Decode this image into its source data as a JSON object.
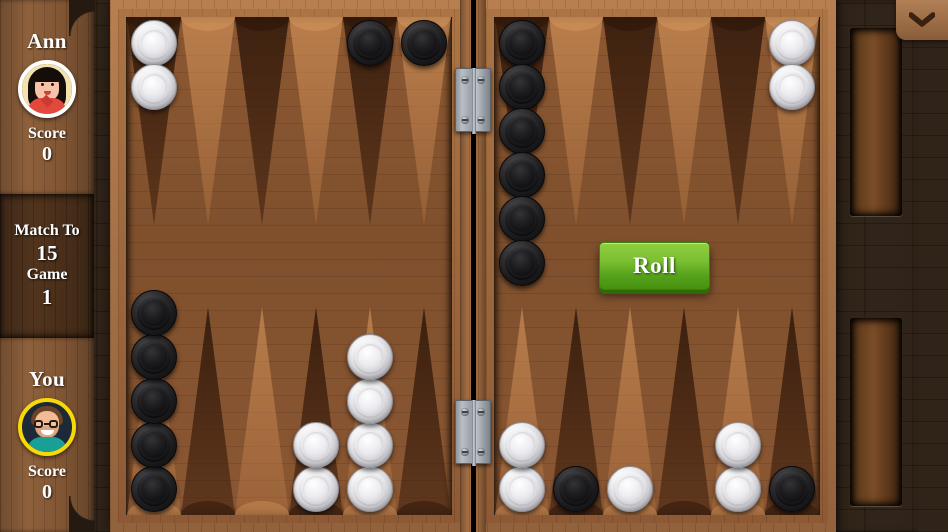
{
  "game": {
    "title": "Backgammon",
    "menu_icon": "chevron-down-icon"
  },
  "sidebar": {
    "opponent": {
      "name": "Ann",
      "avatar_icon": "avatar-ann",
      "score_label": "Score",
      "score_value": "0",
      "ring_color": "#ffffff",
      "active": false
    },
    "match": {
      "match_to_label": "Match To",
      "match_to_value": "15",
      "game_label": "Game",
      "game_value": "1"
    },
    "player": {
      "name": "You",
      "avatar_icon": "avatar-you",
      "score_label": "Score",
      "score_value": "0",
      "ring_color": "#f5d908",
      "active": true
    }
  },
  "board": {
    "roll_button_label": "Roll",
    "roll_button_color": "#7cc133",
    "checker_white_color": "#e6e6ea",
    "checker_black_color": "#1b1b1d",
    "point_dark_color": "#30180a",
    "point_light_color": "#d6965c",
    "bear_off_top_count": "0",
    "bear_off_bottom_count": "0",
    "quadrants": {
      "top_left": [
        {
          "color": "white",
          "count": 2
        },
        {
          "color": "none",
          "count": 0
        },
        {
          "color": "none",
          "count": 0
        },
        {
          "color": "none",
          "count": 0
        },
        {
          "color": "black",
          "count": 1
        },
        {
          "color": "black",
          "count": 1
        }
      ],
      "top_right": [
        {
          "color": "black",
          "count": 6
        },
        {
          "color": "none",
          "count": 0
        },
        {
          "color": "none",
          "count": 0
        },
        {
          "color": "none",
          "count": 0
        },
        {
          "color": "none",
          "count": 0
        },
        {
          "color": "white",
          "count": 2
        }
      ],
      "bottom_left": [
        {
          "color": "black",
          "count": 5
        },
        {
          "color": "none",
          "count": 0
        },
        {
          "color": "none",
          "count": 0
        },
        {
          "color": "white",
          "count": 2
        },
        {
          "color": "white",
          "count": 4
        },
        {
          "color": "none",
          "count": 0
        }
      ],
      "bottom_right": [
        {
          "color": "white",
          "count": 2
        },
        {
          "color": "black",
          "count": 1
        },
        {
          "color": "white",
          "count": 1
        },
        {
          "color": "none",
          "count": 0
        },
        {
          "color": "white",
          "count": 2
        },
        {
          "color": "black",
          "count": 1
        }
      ]
    }
  }
}
